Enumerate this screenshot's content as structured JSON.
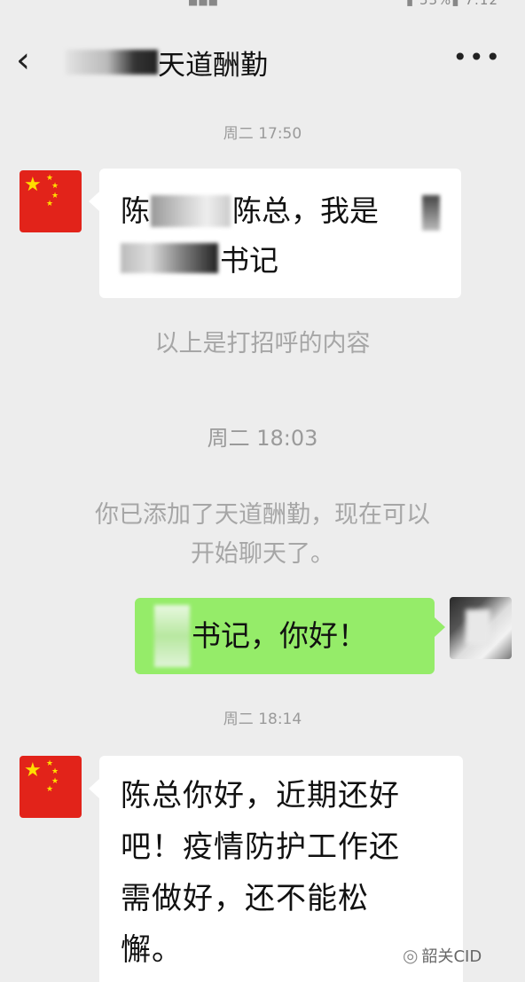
{
  "status_bar": {
    "right_text": "▮ 53%▮ 7:12",
    "left_glyphs": "■■■"
  },
  "header": {
    "back_icon": "chevron-left-icon",
    "title": "天道酬勤",
    "more_label": "•••"
  },
  "chat": {
    "messages": [
      {
        "type": "timestamp",
        "text": "周二 17:50"
      },
      {
        "type": "incoming",
        "avatar": "china-flag",
        "lines": [
          "陈总，我是",
          "书记"
        ]
      },
      {
        "type": "system",
        "text": "以上是打招呼的内容"
      },
      {
        "type": "timestamp",
        "text": "周二 18:03"
      },
      {
        "type": "system",
        "lines": [
          "你已添加了天道酬勤，现在可以",
          "开始聊天了。"
        ]
      },
      {
        "type": "outgoing",
        "avatar": "photo",
        "text": "书记，你好！"
      },
      {
        "type": "timestamp",
        "text": "周二 18:14"
      },
      {
        "type": "incoming",
        "avatar": "china-flag",
        "lines": [
          "陈总你好，近期还好",
          "吧！疫情防护工作还",
          "需做好，还不能松",
          "懈。"
        ]
      }
    ]
  },
  "watermark": {
    "text": "韶关CID"
  },
  "colors": {
    "background": "#ededed",
    "bubble_out": "#95ec69",
    "bubble_in": "#ffffff",
    "flag_red": "#e2231a",
    "flag_star": "#ffde00"
  }
}
